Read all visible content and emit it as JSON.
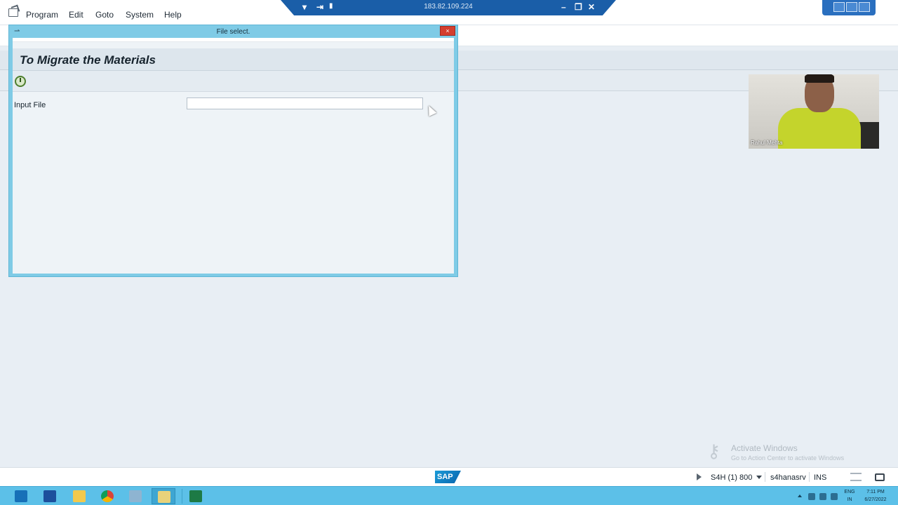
{
  "menu": {
    "items": [
      "Program",
      "Edit",
      "Goto",
      "System",
      "Help"
    ]
  },
  "rdp": {
    "ip": "183.82.109.224",
    "icons": [
      "dropdown-arrow-icon",
      "pin-icon",
      "signal-icon",
      "minimize-icon",
      "restore-icon",
      "close-icon"
    ]
  },
  "dialog": {
    "title": "File select.",
    "close_label": "×"
  },
  "screen": {
    "program_title": "To Migrate the Materials",
    "execute_icon": "execute-clock-icon",
    "input_label": "Input File",
    "input_value": ""
  },
  "webcam": {
    "name": "Rahul Mehta"
  },
  "watermark": {
    "line1": "Activate Windows",
    "line2": "Go to Action Center to activate Windows"
  },
  "status": {
    "logo": "SAP",
    "system": "S4H (1) 800",
    "server": "s4hanasrv",
    "mode": "INS"
  },
  "taskbar": {
    "apps": [
      "server-manager-icon",
      "powershell-icon",
      "file-explorer-icon",
      "chrome-icon",
      "task-manager-icon",
      "sap-logon-icon",
      "excel-icon"
    ],
    "lang1": "ENG",
    "lang2": "IN",
    "time": "7:11 PM",
    "date": "6/27/2022"
  },
  "colors": {
    "dialog_frame": "#7fcbe6",
    "taskbar": "#5cc0e8",
    "rdp_bar": "#1a5ea8",
    "close_button": "#d43f2f"
  }
}
